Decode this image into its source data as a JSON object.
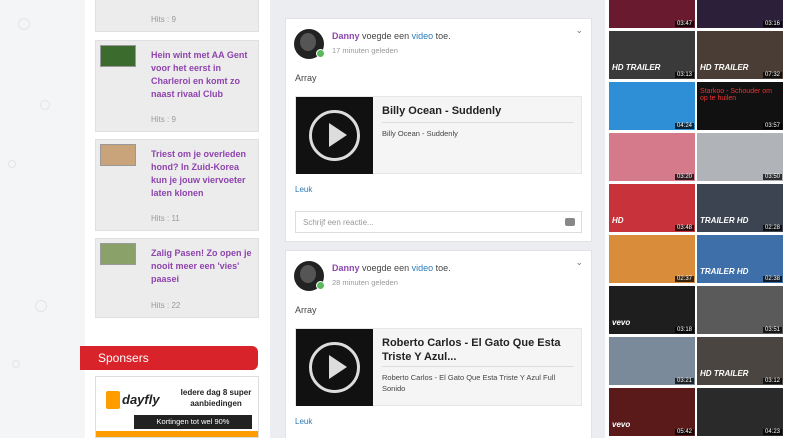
{
  "news": [
    {
      "hits": "Hits : 9",
      "title": ""
    },
    {
      "title": "Hein wint met AA Gent voor het eerst in Charleroi en komt zo naast rivaal Club",
      "hits": "Hits : 9"
    },
    {
      "title": "Triest om je overleden hond? In Zuid-Korea kun je jouw viervoeter laten klonen",
      "hits": "Hits : 11"
    },
    {
      "title": "Zalig Pasen! Zo open je nooit meer een 'vies' paasei",
      "hits": "Hits : 22"
    }
  ],
  "sponsors": {
    "heading": "Sponsers",
    "ad_brand": "dayfly",
    "ad_text": "Iedere dag 8 super aanbiedingen",
    "ad_button": "Kortingen tot wel 90%"
  },
  "posts": [
    {
      "user": "Danny",
      "action_pre": "voegde een",
      "action_link": "video",
      "action_post": "toe.",
      "time": "17 minuten geleden",
      "body": "Array",
      "video_title": "Billy Ocean - Suddenly",
      "video_desc": "Billy Ocean - Suddenly",
      "like": "Leuk",
      "comment_placeholder": "Schrijf een reactie..."
    },
    {
      "user": "Danny",
      "action_pre": "voegde een",
      "action_link": "video",
      "action_post": "toe.",
      "time": "28 minuten geleden",
      "body": "Array",
      "video_title": "Roberto Carlos - El Gato Que Esta Triste Y Azul...",
      "video_desc": "Roberto Carlos - El Gato Que Esta Triste Y Azul Full Sonido",
      "like": "Leuk"
    }
  ],
  "videos": [
    {
      "duration": "03:47",
      "label": "",
      "color": "#6a1a2e"
    },
    {
      "duration": "03:16",
      "label": "",
      "color": "#2b1f3a"
    },
    {
      "duration": "03:13",
      "label": "HD TRAILER",
      "color": "#3a3a3a"
    },
    {
      "duration": "07:32",
      "label": "HD TRAILER",
      "color": "#4a3d35"
    },
    {
      "duration": "04:24",
      "label": "",
      "color": "#2e8fd6"
    },
    {
      "duration": "03:57",
      "label": "Starkoo - Schouder om op te huilen",
      "color": "#111111"
    },
    {
      "duration": "03:20",
      "label": "",
      "color": "#d47a8a"
    },
    {
      "duration": "03:50",
      "label": "",
      "color": "#b0b4b8"
    },
    {
      "duration": "03:48",
      "label": "HD",
      "color": "#c8323a"
    },
    {
      "duration": "02:28",
      "label": "TRAILER HD",
      "color": "#3b4450"
    },
    {
      "duration": "02:37",
      "label": "",
      "color": "#d98c3a"
    },
    {
      "duration": "02:38",
      "label": "TRAILER HD",
      "color": "#3e6fa8"
    },
    {
      "duration": "03:18",
      "label": "vevo",
      "color": "#1e1e1e"
    },
    {
      "duration": "03:51",
      "label": "",
      "color": "#5a5a5a"
    },
    {
      "duration": "03:21",
      "label": "",
      "color": "#7a8a9a"
    },
    {
      "duration": "03:12",
      "label": "HD TRAILER",
      "color": "#4a4540"
    },
    {
      "duration": "05:42",
      "label": "vevo",
      "color": "#5a1a1a"
    },
    {
      "duration": "04:23",
      "label": "",
      "color": "#2a2a2a"
    }
  ]
}
